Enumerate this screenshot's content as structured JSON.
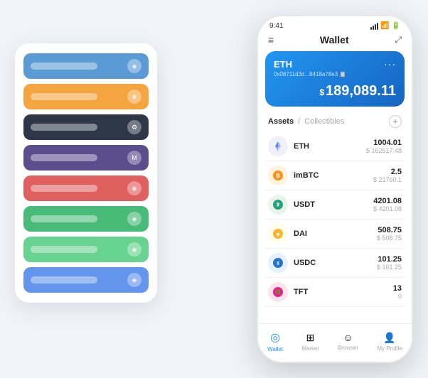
{
  "app": {
    "title": "Wallet",
    "time": "9:41"
  },
  "card_stack": {
    "items": [
      {
        "color": "color-blue",
        "icon": "◈"
      },
      {
        "color": "color-orange",
        "icon": "◈"
      },
      {
        "color": "color-dark",
        "icon": "◈"
      },
      {
        "color": "color-purple",
        "icon": "M"
      },
      {
        "color": "color-red",
        "icon": "◈"
      },
      {
        "color": "color-green",
        "icon": "◈"
      },
      {
        "color": "color-lightgreen",
        "icon": "◈"
      },
      {
        "color": "color-cornflower",
        "icon": "◈"
      }
    ]
  },
  "eth_card": {
    "title": "ETH",
    "address": "0x08711d3d...8418a78e3",
    "dots": "···",
    "balance_symbol": "$",
    "balance": "189,089.11"
  },
  "assets": {
    "tab_active": "Assets",
    "tab_sep": "/",
    "tab_inactive": "Collectibles",
    "add_icon": "+"
  },
  "asset_list": [
    {
      "symbol": "ETH",
      "icon_char": "♦",
      "icon_color": "#627EEA",
      "qty": "1004.01",
      "usd": "$ 162517.48"
    },
    {
      "symbol": "imBTC",
      "icon_char": "⊕",
      "icon_color": "#F7931A",
      "qty": "2.5",
      "usd": "$ 21760.1"
    },
    {
      "symbol": "USDT",
      "icon_char": "₮",
      "icon_color": "#26A17B",
      "qty": "4201.08",
      "usd": "$ 4201.08"
    },
    {
      "symbol": "DAI",
      "icon_char": "◈",
      "icon_color": "#F4B731",
      "qty": "508.75",
      "usd": "$ 508.75"
    },
    {
      "symbol": "USDC",
      "icon_char": "⊙",
      "icon_color": "#2775CA",
      "qty": "101.25",
      "usd": "$ 101.25"
    },
    {
      "symbol": "TFT",
      "icon_char": "🌿",
      "icon_color": "#E91E8C",
      "qty": "13",
      "usd": "0"
    }
  ],
  "bottom_nav": [
    {
      "label": "Wallet",
      "icon": "◎",
      "active": true
    },
    {
      "label": "Market",
      "icon": "📈",
      "active": false
    },
    {
      "label": "Browser",
      "icon": "👤",
      "active": false
    },
    {
      "label": "My Profile",
      "icon": "👤",
      "active": false
    }
  ]
}
